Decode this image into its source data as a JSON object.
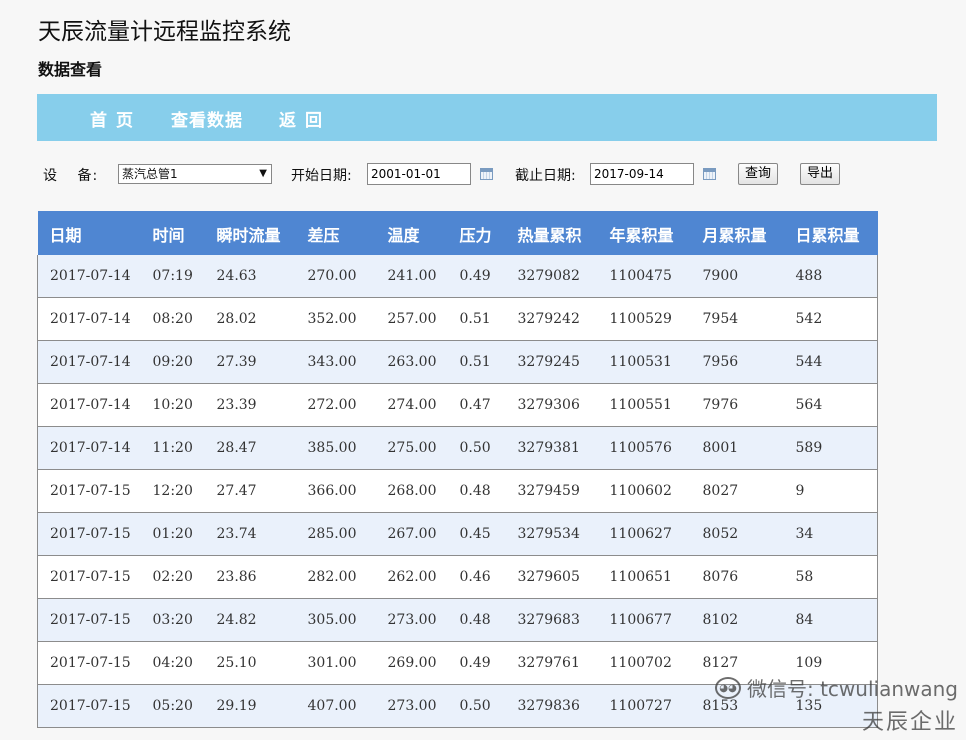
{
  "app": {
    "title": "天辰流量计远程监控系统",
    "subtitle": "数据查看"
  },
  "nav": {
    "home": "首页",
    "view": "查看数据",
    "back": "返回"
  },
  "filter": {
    "device_label": "设 备:",
    "device_value": "蒸汽总管1",
    "start_label": "开始日期:",
    "start_value": "2001-01-01",
    "end_label": "截止日期:",
    "end_value": "2017-09-14",
    "query_button": "查询",
    "export_button": "导出"
  },
  "table": {
    "headers": [
      "日期",
      "时间",
      "瞬时流量",
      "差压",
      "温度",
      "压力",
      "热量累积",
      "年累积量",
      "月累积量",
      "日累积量"
    ],
    "rows": [
      [
        "2017-07-14",
        "07:19",
        "24.63",
        "270.00",
        "241.00",
        "0.49",
        "3279082",
        "1100475",
        "7900",
        "488"
      ],
      [
        "2017-07-14",
        "08:20",
        "28.02",
        "352.00",
        "257.00",
        "0.51",
        "3279242",
        "1100529",
        "7954",
        "542"
      ],
      [
        "2017-07-14",
        "09:20",
        "27.39",
        "343.00",
        "263.00",
        "0.51",
        "3279245",
        "1100531",
        "7956",
        "544"
      ],
      [
        "2017-07-14",
        "10:20",
        "23.39",
        "272.00",
        "274.00",
        "0.47",
        "3279306",
        "1100551",
        "7976",
        "564"
      ],
      [
        "2017-07-14",
        "11:20",
        "28.47",
        "385.00",
        "275.00",
        "0.50",
        "3279381",
        "1100576",
        "8001",
        "589"
      ],
      [
        "2017-07-15",
        "12:20",
        "27.47",
        "366.00",
        "268.00",
        "0.48",
        "3279459",
        "1100602",
        "8027",
        "9"
      ],
      [
        "2017-07-15",
        "01:20",
        "23.74",
        "285.00",
        "267.00",
        "0.45",
        "3279534",
        "1100627",
        "8052",
        "34"
      ],
      [
        "2017-07-15",
        "02:20",
        "23.86",
        "282.00",
        "262.00",
        "0.46",
        "3279605",
        "1100651",
        "8076",
        "58"
      ],
      [
        "2017-07-15",
        "03:20",
        "24.82",
        "305.00",
        "273.00",
        "0.48",
        "3279683",
        "1100677",
        "8102",
        "84"
      ],
      [
        "2017-07-15",
        "04:20",
        "25.10",
        "301.00",
        "269.00",
        "0.49",
        "3279761",
        "1100702",
        "8127",
        "109"
      ],
      [
        "2017-07-15",
        "05:20",
        "29.19",
        "407.00",
        "273.00",
        "0.50",
        "3279836",
        "1100727",
        "8153",
        "135"
      ]
    ]
  },
  "watermark": {
    "line1": "微信号: tcwulianwang",
    "line2": "天辰企业",
    "icon": "wechat-icon"
  },
  "colors": {
    "nav_bg": "#87ceeb",
    "header_bg": "#4f86d2",
    "row_alt_bg": "#eaf1fb"
  }
}
